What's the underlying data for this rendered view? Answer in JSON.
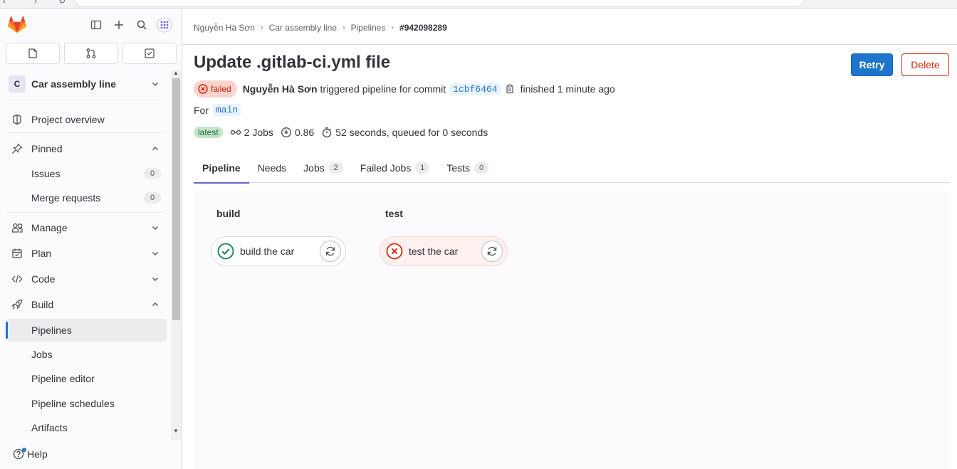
{
  "sidebar": {
    "project": {
      "avatar_letter": "C",
      "name": "Car assembly line"
    },
    "items": {
      "project_overview": "Project overview",
      "pinned": "Pinned",
      "issues": {
        "label": "Issues",
        "count": "0"
      },
      "merge_requests": {
        "label": "Merge requests",
        "count": "0"
      },
      "manage": "Manage",
      "plan": "Plan",
      "code": "Code",
      "build": "Build",
      "pipelines": "Pipelines",
      "jobs": "Jobs",
      "pipeline_editor": "Pipeline editor",
      "pipeline_schedules": "Pipeline schedules",
      "artifacts": "Artifacts"
    },
    "help": "Help"
  },
  "breadcrumb": {
    "user": "Nguyễn Hà Sơn",
    "project": "Car assembly line",
    "section": "Pipelines",
    "current": "#942098289"
  },
  "header": {
    "title": "Update .gitlab-ci.yml file",
    "retry_label": "Retry",
    "delete_label": "Delete"
  },
  "meta": {
    "status": "failed",
    "author": "Nguyễn Hà Sơn",
    "triggered_text": "triggered pipeline for commit",
    "commit_sha": "1cbf6464",
    "finished_text": "finished 1 minute ago",
    "for_label": "For",
    "branch": "main"
  },
  "stats": {
    "latest_badge": "latest",
    "jobs": "2 Jobs",
    "coverage": "0.86",
    "duration": "52 seconds, queued for 0 seconds"
  },
  "tabs": [
    {
      "label": "Pipeline",
      "count": null
    },
    {
      "label": "Needs",
      "count": null
    },
    {
      "label": "Jobs",
      "count": "2"
    },
    {
      "label": "Failed Jobs",
      "count": "1"
    },
    {
      "label": "Tests",
      "count": "0"
    }
  ],
  "stages": [
    {
      "name": "build",
      "job": {
        "name": "build the car",
        "status": "success"
      }
    },
    {
      "name": "test",
      "job": {
        "name": "test the car",
        "status": "failed"
      }
    }
  ],
  "colors": {
    "primary": "#1f75cb",
    "danger": "#dd2b0e",
    "success": "#108548",
    "failed": "#dd2b0e",
    "tab_underline": "#6666c4"
  }
}
